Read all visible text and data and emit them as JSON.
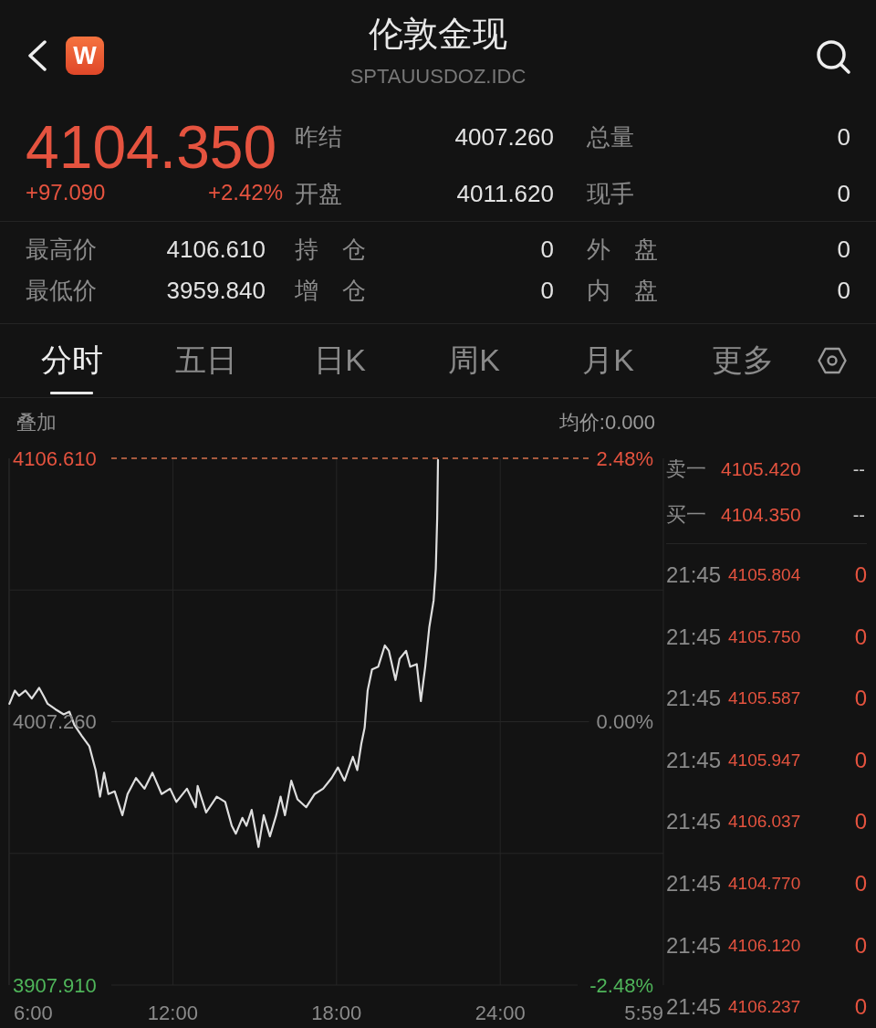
{
  "header": {
    "title": "伦敦金现",
    "subtitle": "SPTAUUSDOZ.IDC",
    "logo_text": "W"
  },
  "quote": {
    "price": "4104.350",
    "change": "+97.090",
    "change_percent": "+2.42%",
    "rising": true,
    "rows": [
      {
        "cells": [
          {
            "label": "昨结",
            "value": "4007.260"
          },
          {
            "label": "总量",
            "value": "0"
          }
        ]
      },
      {
        "cells": [
          {
            "label": "开盘",
            "value": "4011.620"
          },
          {
            "label": "现手",
            "value": "0"
          }
        ]
      }
    ]
  },
  "stats": {
    "rows": [
      {
        "cells": [
          {
            "label": "最高价",
            "value": "4106.610"
          },
          {
            "label": "持 仓",
            "value": "0"
          },
          {
            "label": "外 盘",
            "value": "0"
          }
        ]
      },
      {
        "cells": [
          {
            "label": "最低价",
            "value": "3959.840"
          },
          {
            "label": "增 仓",
            "value": "0"
          },
          {
            "label": "内 盘",
            "value": "0"
          }
        ]
      }
    ]
  },
  "tabs": [
    {
      "label": "分时",
      "selected": true
    },
    {
      "label": "五日",
      "selected": false
    },
    {
      "label": "日K",
      "selected": false
    },
    {
      "label": "周K",
      "selected": false
    },
    {
      "label": "月K",
      "selected": false
    },
    {
      "label": "更多",
      "selected": false
    }
  ],
  "chart": {
    "overlay_label": "叠加",
    "average_label": "均价:0.000",
    "percent_labels": [
      "2.48%",
      "0.00%",
      "-2.48%"
    ],
    "axis_end_label": "5:59",
    "chart_data": {
      "type": "line",
      "grid": true,
      "x": [
        6.01,
        6.21,
        6.36,
        6.6,
        6.83,
        7.1,
        7.26,
        7.41,
        7.69,
        8.0,
        8.21,
        8.39,
        8.66,
        8.94,
        9.17,
        9.33,
        9.48,
        9.64,
        9.87,
        10.15,
        10.34,
        10.65,
        10.96,
        11.25,
        11.59,
        11.9,
        12.13,
        12.52,
        12.84,
        12.91,
        13.22,
        13.61,
        13.92,
        14.16,
        14.31,
        14.55,
        14.7,
        14.89,
        15.14,
        15.33,
        15.56,
        15.79,
        15.95,
        16.11,
        16.34,
        16.57,
        16.89,
        17.2,
        17.51,
        17.82,
        18.05,
        18.29,
        18.6,
        18.76,
        18.91,
        19.03,
        19.14,
        19.3,
        19.53,
        19.77,
        19.92,
        20.16,
        20.31,
        20.55,
        20.7,
        20.94,
        21.09,
        21.25,
        21.4,
        21.56,
        21.64,
        21.69,
        21.72
      ],
      "series": [
        {
          "color": "#dedede",
          "values": [
            4014,
            4019,
            4017,
            4019,
            4016,
            4020,
            4017,
            4014,
            4012,
            4010,
            4011,
            4006,
            4002,
            3998,
            3989,
            3979,
            3988,
            3980,
            3981,
            3972,
            3980,
            3986,
            3982,
            3988,
            3980,
            3982,
            3977,
            3982,
            3975,
            3983,
            3973,
            3979,
            3977,
            3968,
            3965,
            3971,
            3968,
            3974,
            3960,
            3972,
            3964,
            3972,
            3979,
            3972,
            3985,
            3978,
            3975,
            3980,
            3982,
            3986,
            3990,
            3985,
            3994,
            3989,
            3999,
            4005,
            4019,
            4027,
            4028,
            4036,
            4034,
            4023,
            4031,
            4034,
            4028,
            4029,
            4015,
            4028,
            4043,
            4053,
            4065,
            4084,
            4106
          ]
        }
      ],
      "xlim": [
        6,
        29.98
      ],
      "ylim": [
        3907.91,
        4106.61
      ],
      "xticks": [
        {
          "value": 6,
          "label": "6:00"
        },
        {
          "value": 12,
          "label": "12:00"
        },
        {
          "value": 18,
          "label": "18:00"
        },
        {
          "value": 24,
          "label": "24:00"
        }
      ],
      "yticks": [
        {
          "value": 4106.61,
          "label": "4106.610"
        },
        {
          "value": 4007.26,
          "label": "4007.260"
        },
        {
          "value": 3907.91,
          "label": "3907.910"
        }
      ]
    }
  },
  "order_book": {
    "quotes": [
      {
        "label": "卖一",
        "price": "4105.420",
        "volume": "--",
        "rising": true
      },
      {
        "label": "买一",
        "price": "4104.350",
        "volume": "--",
        "rising": true
      }
    ],
    "trades": [
      {
        "time": "21:45",
        "price": "4105.804",
        "volume": "0",
        "rising": true
      },
      {
        "time": "21:45",
        "price": "4105.750",
        "volume": "0",
        "rising": true
      },
      {
        "time": "21:45",
        "price": "4105.587",
        "volume": "0",
        "rising": true
      },
      {
        "time": "21:45",
        "price": "4105.947",
        "volume": "0",
        "rising": true
      },
      {
        "time": "21:45",
        "price": "4106.037",
        "volume": "0",
        "rising": true
      },
      {
        "time": "21:45",
        "price": "4104.770",
        "volume": "0",
        "rising": true
      },
      {
        "time": "21:45",
        "price": "4106.120",
        "volume": "0",
        "rising": true
      },
      {
        "time": "21:45",
        "price": "4106.237",
        "volume": "0",
        "rising": true
      }
    ]
  }
}
